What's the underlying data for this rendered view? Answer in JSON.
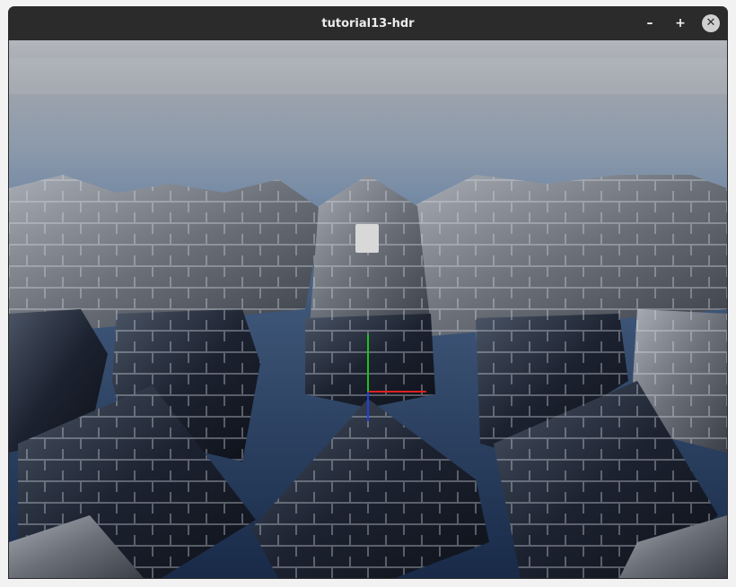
{
  "window": {
    "title": "tutorial13-hdr",
    "buttons": {
      "minimize": "–",
      "maximize": "+",
      "close": "✕"
    }
  },
  "scene": {
    "description_colors": {
      "sky_top": "#a8adb5",
      "sky_horizon": "#7f93ab",
      "floor": "#1e3355",
      "stone_light": "#8f949e",
      "stone_dark": "#1f2530",
      "light_cube": "#d9d9d9",
      "axis_x": "#e02020",
      "axis_y": "#20c020",
      "axis_z": "#2040e0"
    }
  }
}
